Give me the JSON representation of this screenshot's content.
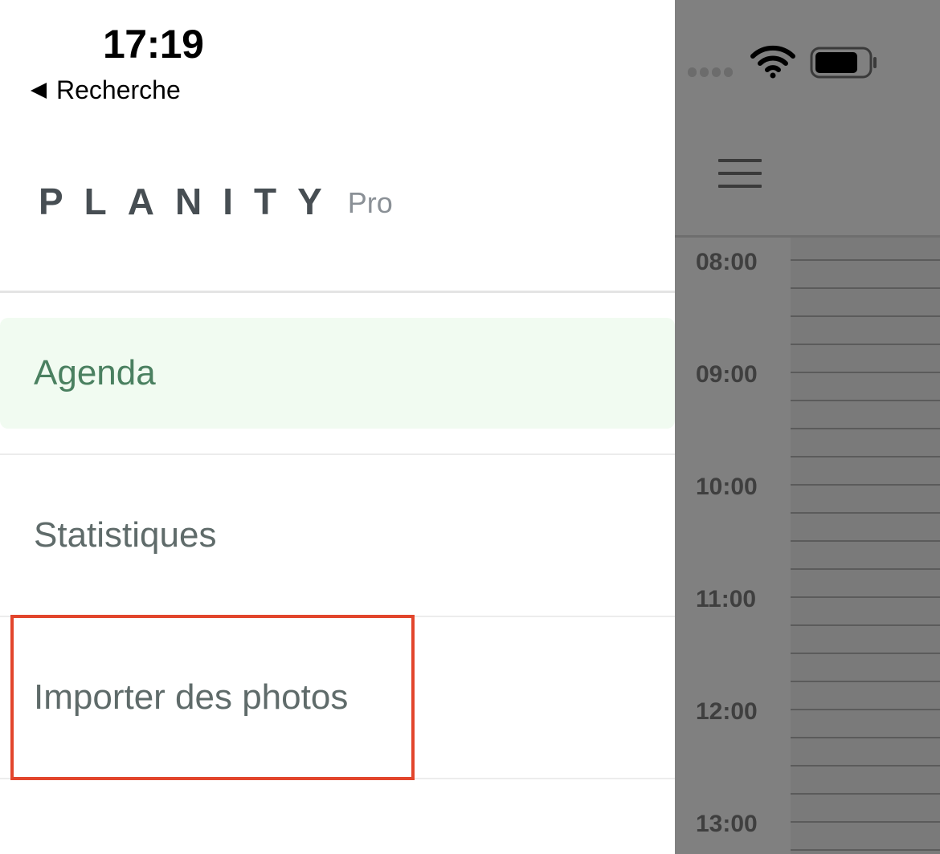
{
  "status_bar": {
    "time": "17:19",
    "back_label": "Recherche"
  },
  "brand": {
    "logo": "PLANITY",
    "suffix": "Pro"
  },
  "menu": {
    "items": [
      {
        "label": "Agenda",
        "active": true
      },
      {
        "label": "Statistiques",
        "active": false
      },
      {
        "label": "Importer des photos",
        "active": false,
        "highlighted": true
      }
    ]
  },
  "calendar": {
    "hours": [
      "08:00",
      "09:00",
      "10:00",
      "11:00",
      "12:00",
      "13:00"
    ]
  },
  "colors": {
    "active_text": "#4a8060",
    "active_bg": "#f1fbf1",
    "highlight_border": "#e2452c",
    "overlay": "#808080"
  }
}
